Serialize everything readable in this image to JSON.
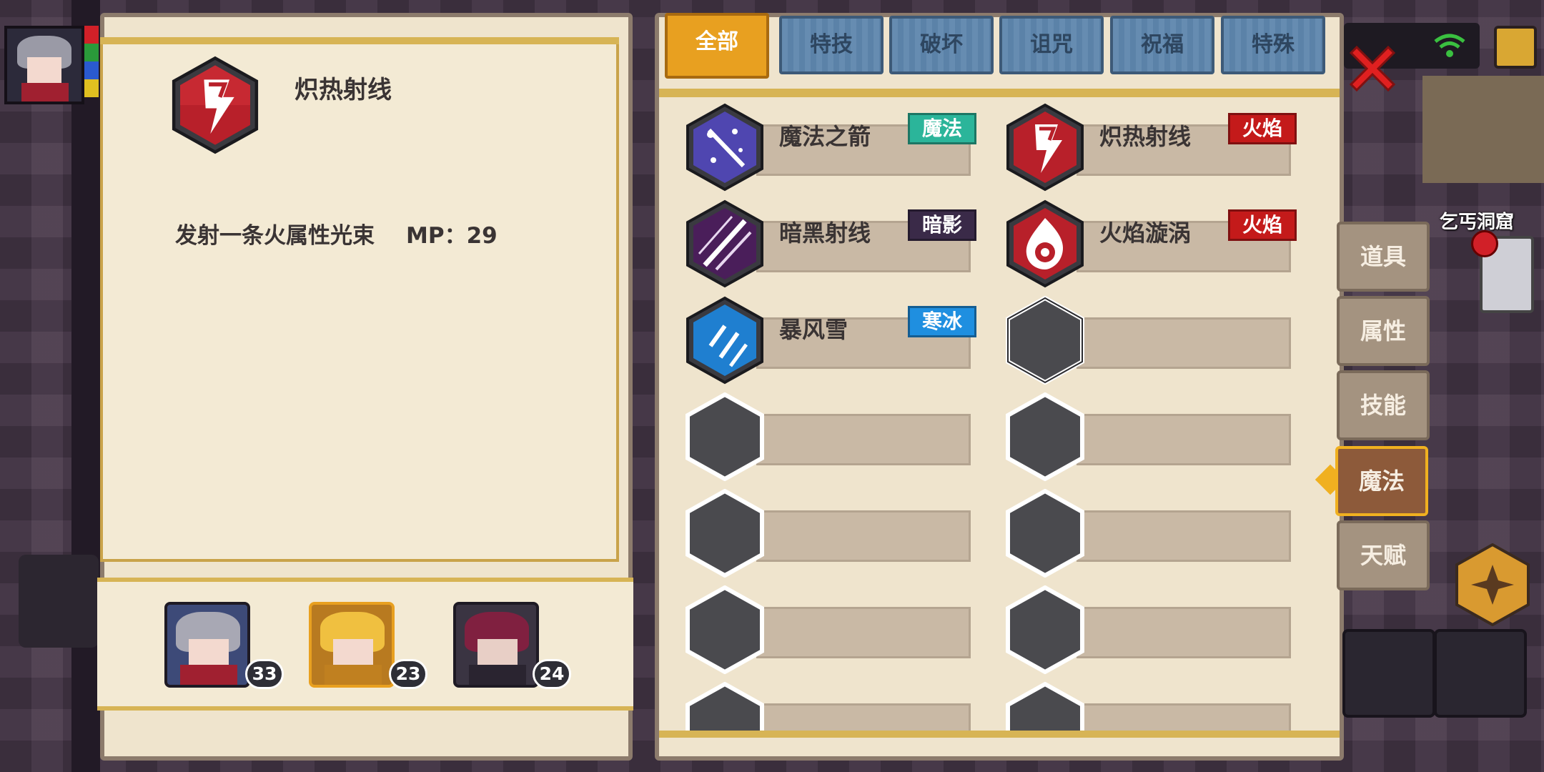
{
  "info": {
    "title": "炽热射线",
    "description": "发射一条火属性光束",
    "mp": "MP：29"
  },
  "characters": [
    {
      "level": "33",
      "selected": false
    },
    {
      "level": "23",
      "selected": true
    },
    {
      "level": "24",
      "selected": false
    }
  ],
  "tabs": [
    "全部",
    "特技",
    "破坏",
    "诅咒",
    "祝福",
    "特殊"
  ],
  "active_tab": "全部",
  "skills": [
    {
      "name": "魔法之箭",
      "tag": "魔法",
      "tag_color": "#2bb59a",
      "icon": "arrow-magic-icon"
    },
    {
      "name": "炽热射线",
      "tag": "火焰",
      "tag_color": "#c41a1a",
      "icon": "fire-ray-icon"
    },
    {
      "name": "暗黑射线",
      "tag": "暗影",
      "tag_color": "#3a2a48",
      "icon": "dark-ray-icon"
    },
    {
      "name": "火焰漩涡",
      "tag": "火焰",
      "tag_color": "#c41a1a",
      "icon": "fire-vortex-icon"
    },
    {
      "name": "暴风雪",
      "tag": "寒冰",
      "tag_color": "#1f8fe0",
      "icon": "blizzard-icon"
    }
  ],
  "side_menu": [
    "道具",
    "属性",
    "技能",
    "魔法",
    "天赋"
  ],
  "side_active": "魔法",
  "map_name": "乞丐洞窟",
  "colors": {
    "tab_active": "#e8a020",
    "tab_inactive": "#5e86ad",
    "panel": "#efe4cd",
    "accent_gold": "#d7b455"
  }
}
